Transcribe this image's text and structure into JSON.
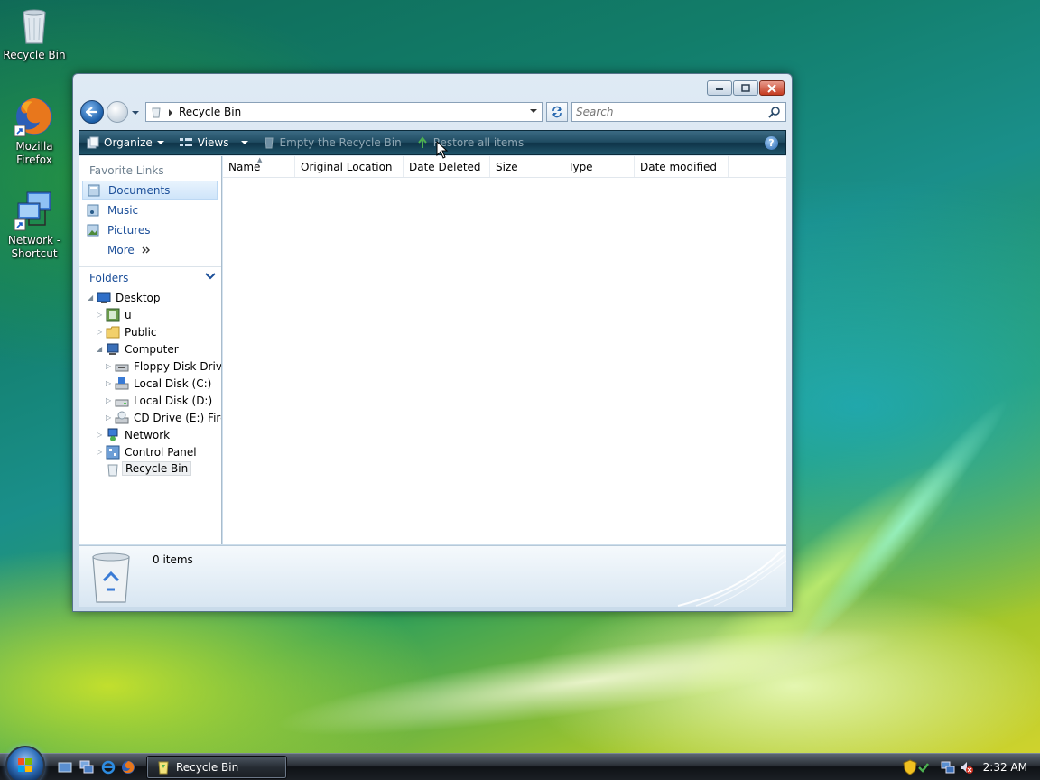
{
  "desktop": {
    "icons": [
      {
        "label": "Recycle Bin",
        "icon": "recycle-bin-icon"
      },
      {
        "label": "Mozilla Firefox",
        "icon": "firefox-icon"
      },
      {
        "label": "Network - Shortcut",
        "icon": "network-shortcut-icon"
      }
    ]
  },
  "window": {
    "address": {
      "crumb": "Recycle Bin"
    },
    "search": {
      "placeholder": "Search"
    },
    "commands": {
      "organize": "Organize",
      "views": "Views",
      "empty": "Empty the Recycle Bin",
      "restore": "Restore all items"
    },
    "favorites": {
      "title": "Favorite Links",
      "items": [
        "Documents",
        "Music",
        "Pictures",
        "More"
      ]
    },
    "folders": {
      "title": "Folders",
      "tree": [
        {
          "label": "Desktop"
        },
        {
          "label": "u"
        },
        {
          "label": "Public"
        },
        {
          "label": "Computer"
        },
        {
          "label": "Floppy Disk Drive"
        },
        {
          "label": "Local Disk (C:)"
        },
        {
          "label": "Local Disk (D:)"
        },
        {
          "label": "CD Drive (E:) Firefox"
        },
        {
          "label": "Network"
        },
        {
          "label": "Control Panel"
        },
        {
          "label": "Recycle Bin"
        }
      ]
    },
    "columns": [
      "Name",
      "Original Location",
      "Date Deleted",
      "Size",
      "Type",
      "Date modified"
    ],
    "details": {
      "count": "0 items"
    }
  },
  "taskbar": {
    "task": "Recycle Bin",
    "clock": "2:32 AM"
  },
  "colors": {
    "accent": "#1c4f99",
    "commandbar": "#1f4b61",
    "selection": "#cfe5fa"
  }
}
